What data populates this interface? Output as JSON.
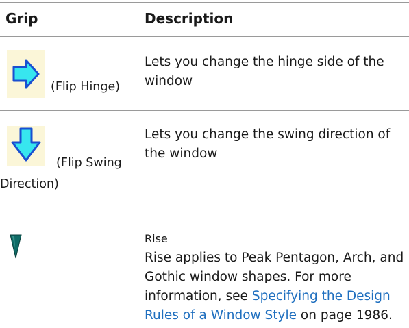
{
  "table": {
    "headers": {
      "grip": "Grip",
      "description": "Description"
    },
    "rows": [
      {
        "icon": "flip-hinge-arrow-right-icon",
        "grip_label": "(Flip Hinge)",
        "description": "Lets you change the hinge side of the window"
      },
      {
        "icon": "flip-swing-arrow-down-icon",
        "grip_label_line1": "(Flip Swing",
        "grip_label_line2": "Direction)",
        "description": "Lets you change the swing direction of the window"
      },
      {
        "icon": "rise-triangle-icon",
        "title": "Rise",
        "description_before": "Rise applies to Peak Pentagon, Arch, and Gothic window shapes. For more information, see ",
        "link_text": "Specifying the Design Rules of a Window Style",
        "description_after": " on page 1986."
      }
    ]
  },
  "colors": {
    "rule": "#9a9a9a",
    "link": "#1f6fbf",
    "arrow_fill": "#37e6ef",
    "arrow_stroke": "#1a4fd1",
    "icon_bg": "#fbf6d8",
    "rise_fill": "#0f6b66"
  }
}
